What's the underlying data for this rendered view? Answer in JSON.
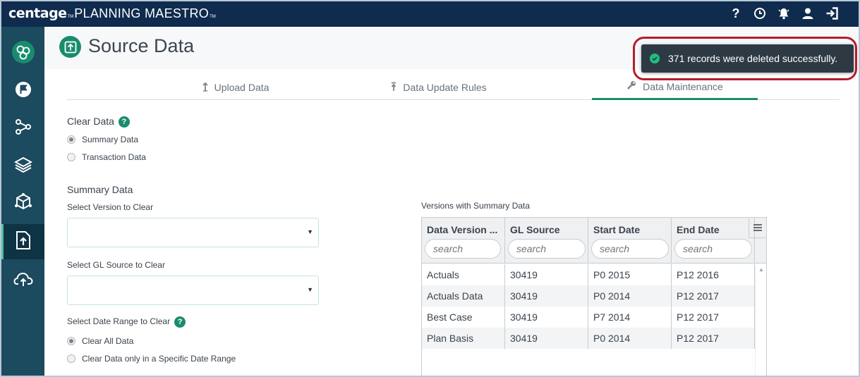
{
  "app": {
    "brand": "centage",
    "brand_tm": "TM",
    "product": "PLANNING MAESTRO",
    "product_tm": "TM"
  },
  "topbar_icons": [
    "help-icon",
    "history-icon",
    "notifications-icon",
    "user-icon",
    "logout-icon"
  ],
  "topbar_help_glyph": "?",
  "sidebar": {
    "items": [
      {
        "icon": "org-chart-icon"
      },
      {
        "icon": "flag-icon"
      },
      {
        "icon": "workflow-icon"
      },
      {
        "icon": "layers-icon"
      },
      {
        "icon": "model-icon"
      },
      {
        "icon": "source-data-icon",
        "active": true
      },
      {
        "icon": "cloud-upload-icon"
      }
    ]
  },
  "page": {
    "title": "Source Data"
  },
  "toast": {
    "message": "371 records were deleted successfully."
  },
  "tabs": [
    {
      "label": "Upload Data",
      "icon": "upload-icon"
    },
    {
      "label": "Data Update Rules",
      "icon": "rules-icon"
    },
    {
      "label": "Data Maintenance",
      "icon": "wrench-icon",
      "active": true
    }
  ],
  "clear_data": {
    "heading": "Clear Data",
    "help": "?",
    "options": [
      {
        "label": "Summary Data",
        "selected": true
      },
      {
        "label": "Transaction Data",
        "selected": false
      }
    ]
  },
  "summary": {
    "heading": "Summary Data",
    "version_label": "Select Version to Clear",
    "version_value": "",
    "gl_label": "Select GL Source to Clear",
    "gl_value": "",
    "date_label": "Select Date Range to Clear",
    "date_help": "?",
    "date_options": [
      {
        "label": "Clear All Data",
        "selected": true
      },
      {
        "label": "Clear Data only in a Specific Date Range",
        "selected": false
      }
    ]
  },
  "grid": {
    "title": "Versions with Summary Data",
    "columns": [
      "Data Version ...",
      "GL Source",
      "Start Date",
      "End Date"
    ],
    "search_placeholder": "search",
    "rows": [
      [
        "Actuals",
        "30419",
        "P0 2015",
        "P12 2016"
      ],
      [
        "Actuals Data",
        "30419",
        "P0 2014",
        "P12 2017"
      ],
      [
        "Best Case",
        "30419",
        "P7 2014",
        "P12 2017"
      ],
      [
        "Plan Basis",
        "30419",
        "P0 2014",
        "P12 2017"
      ]
    ]
  },
  "colors": {
    "topbar": "#0f2b4e",
    "sidebar": "#1c4a5e",
    "accent": "#1a8c6e",
    "toast_bg": "#2d3a44",
    "toast_ring": "#b71c2c"
  }
}
